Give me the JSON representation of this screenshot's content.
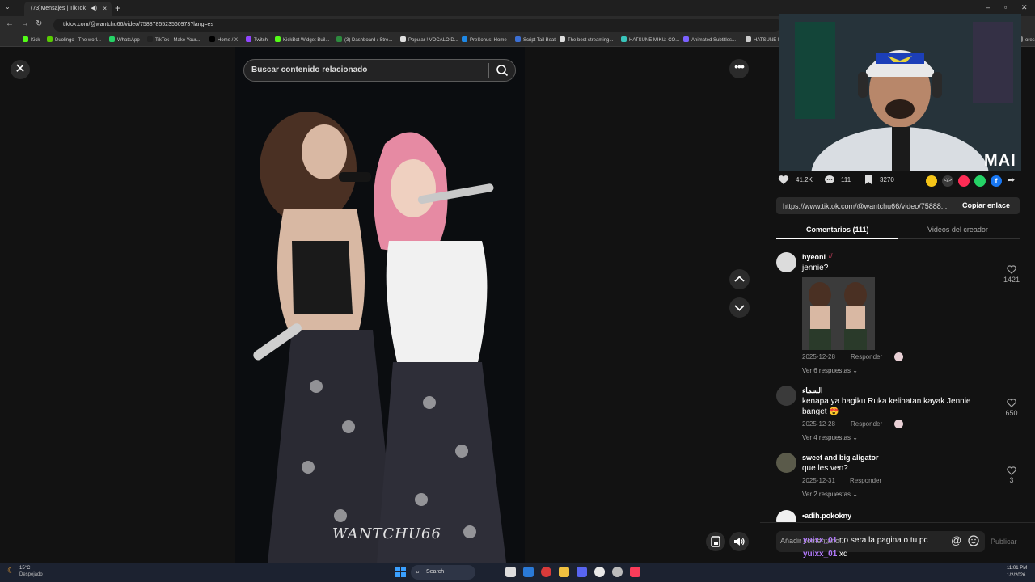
{
  "browser": {
    "tab_title": "(73)Mensajes | TikTok",
    "url": "tiktok.com/@wantchu66/video/7588785523560973?lang=es",
    "bookmarks": [
      {
        "label": "Kick",
        "color": "#53fc18"
      },
      {
        "label": "Duolingo - The worl...",
        "color": "#58cc02"
      },
      {
        "label": "WhatsApp",
        "color": "#25d366"
      },
      {
        "label": "TikTok - Make Your...",
        "color": "#222222"
      },
      {
        "label": "Home / X",
        "color": "#000000"
      },
      {
        "label": "Twitch",
        "color": "#9146ff"
      },
      {
        "label": "KickBot Widget Buil...",
        "color": "#53fc18"
      },
      {
        "label": "(3) Dashboard / Stre...",
        "color": "#2d8a3e"
      },
      {
        "label": "Popular ! VOCALOID...",
        "color": "#e0e0e0"
      },
      {
        "label": "PreSonus: Home",
        "color": "#1e88e5"
      },
      {
        "label": "Script Tail Beat",
        "color": "#3b6fd4"
      },
      {
        "label": "The best streaming...",
        "color": "#dddddd"
      },
      {
        "label": "HATSUNE MIKU: CO...",
        "color": "#39c5bb"
      },
      {
        "label": "Animated Subtitles...",
        "color": "#7b61ff"
      },
      {
        "label": "HATSUNE MIKU...",
        "color": "#cccccc"
      },
      {
        "label": "ores",
        "color": "#888888"
      }
    ]
  },
  "search": {
    "placeholder": "Buscar contenido relacionado"
  },
  "video": {
    "watermark": "WANTCHU66"
  },
  "webcam": {
    "label": "MAI"
  },
  "stats": {
    "likes": "41.2K",
    "comments": "111",
    "saves": "3270"
  },
  "share_colors": [
    "#f5c518",
    "#3a3a3a",
    "#fe2c55",
    "#25d366",
    "#1877f2"
  ],
  "link": {
    "text": "https://www.tiktok.com/@wantchu66/video/75888...",
    "copy_label": "Copiar enlace"
  },
  "tabs": {
    "comments": "Comentarios (111)",
    "creator": "Videos del creador"
  },
  "comments": [
    {
      "user": "hyeoni",
      "text": "jennie?",
      "date": "2025-12-28",
      "reply": "Responder",
      "likes": "1421",
      "more": "Ver 6 respuestas"
    },
    {
      "user": "السماء",
      "text": "kenapa ya bagiku Ruka kelihatan kayak Jennie banget 😍",
      "date": "2025-12-28",
      "reply": "Responder",
      "likes": "650",
      "more": "Ver 4 respuestas"
    },
    {
      "user": "sweet and big aligator",
      "text": "que les ven?",
      "date": "2025-12-31",
      "reply": "Responder",
      "likes": "3",
      "more": "Ver 2 respuestas"
    },
    {
      "user": "•adih.pokokny"
    }
  ],
  "overlay": {
    "chat1_user": "yuixx_01",
    "chat1_text": "no sera la pagina o tu pc",
    "chat2_user": "yuixx_01",
    "chat2_text": "xd"
  },
  "input": {
    "placeholder": "Añadir comentario...",
    "publish": "Publicar"
  },
  "taskbar": {
    "temp": "15°C",
    "weather": "Despejado",
    "search": "Search",
    "time": "11:01 PM",
    "date": "1/2/2026"
  }
}
